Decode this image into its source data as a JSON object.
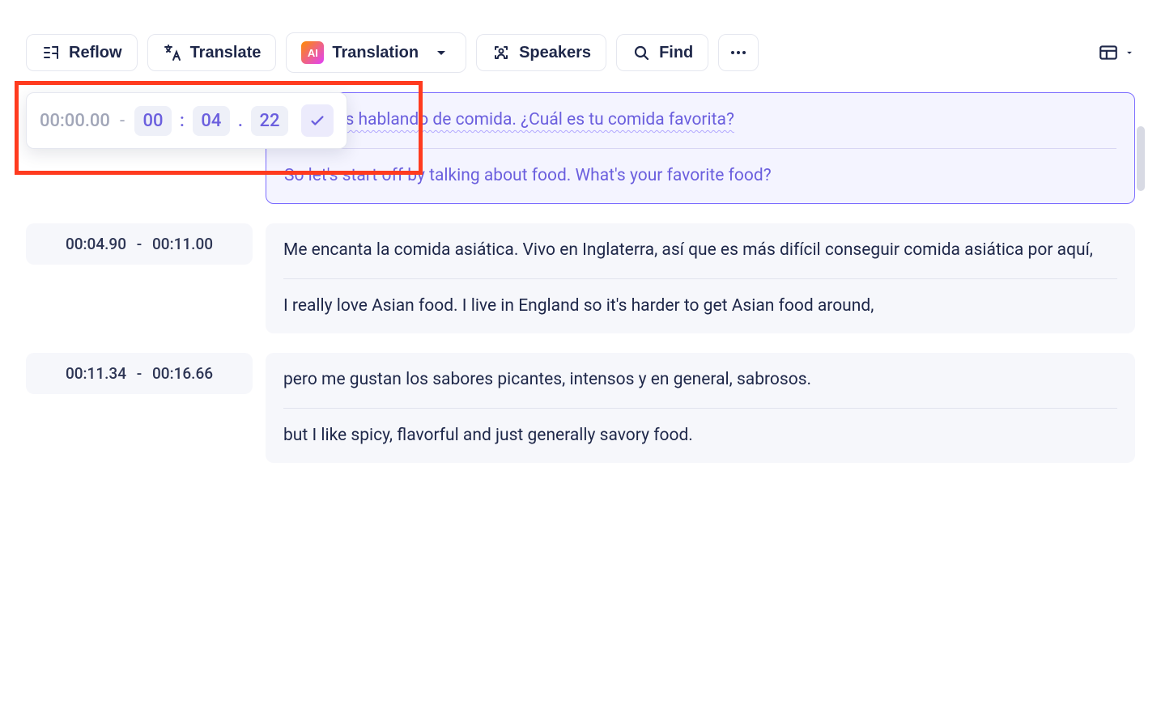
{
  "toolbar": {
    "reflow_label": "Reflow",
    "translate_label": "Translate",
    "translation_label": "Translation",
    "speakers_label": "Speakers",
    "find_label": "Find",
    "ai_badge": "AI"
  },
  "time_editor": {
    "start": "00:00.00",
    "end_min": "00",
    "end_sec": "04",
    "end_cs": "22"
  },
  "segments": [
    {
      "start": "00:00.00",
      "end": "00:04.22",
      "source": "pecemos hablando de comida. ¿Cuál es tu comida favorita?",
      "translation": "So let's start off by talking about food. What's your favorite food?",
      "active": true
    },
    {
      "start": "00:04.90",
      "end": "00:11.00",
      "source": "Me encanta la comida asiática. Vivo en Inglaterra, así que es más difícil conseguir comida asiática por aquí,",
      "translation": "I really love Asian food. I live in England so it's harder to get Asian food around,",
      "active": false
    },
    {
      "start": "00:11.34",
      "end": "00:16.66",
      "source": "pero me gustan los sabores picantes, intensos y en general, sabrosos.",
      "translation": "but I like spicy, flavorful and just generally savory food.",
      "active": false
    }
  ]
}
